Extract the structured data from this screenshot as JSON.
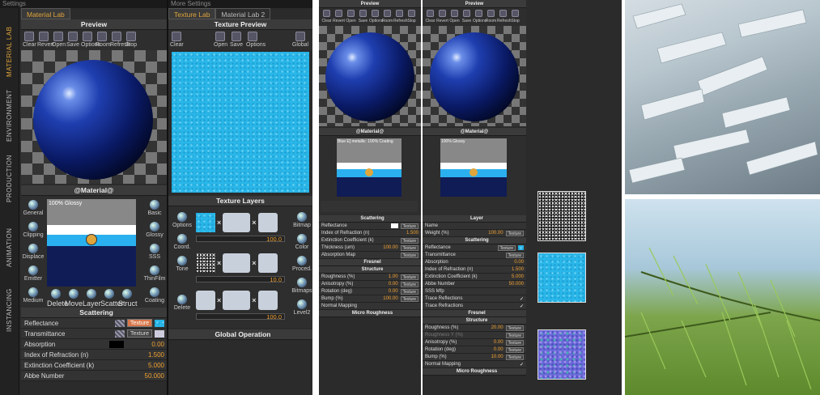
{
  "left": {
    "titlebar": "Settings",
    "tab": "Material Lab",
    "vtabs": [
      "MATERIAL LAB",
      "ENVIRONMENT",
      "PRODUCTION",
      "ANIMATION",
      "INSTANCING"
    ],
    "preview_title": "Preview",
    "toolbar": [
      "Clear",
      "Revert",
      "Open",
      "Save",
      "Options",
      "Room",
      "Refresh",
      "Stop"
    ],
    "material_title": "@Material@",
    "layer_label": "100% Glossy",
    "left_icons": [
      "General",
      "Clipping",
      "Displace",
      "Emitter",
      "Medium"
    ],
    "right_icons": [
      "Basic",
      "Glossy",
      "SSS",
      "ThinFilm",
      "Coating"
    ],
    "bottom_icons": [
      "Delete",
      "Move",
      "Layer",
      "Scatter",
      "Struct"
    ],
    "scattering_title": "Scattering",
    "rows": [
      {
        "label": "Reflectance",
        "value": "",
        "button": "Texture"
      },
      {
        "label": "Transmittance",
        "value": "",
        "button": "Texture"
      },
      {
        "label": "Absorption",
        "value": "0.00",
        "button": ""
      },
      {
        "label": "Index of Refraction (n)",
        "value": "1.500",
        "button": ""
      },
      {
        "label": "Extinction Coefficient (k)",
        "value": "5.000",
        "button": ""
      },
      {
        "label": "Abbe Number",
        "value": "50.000",
        "button": ""
      }
    ]
  },
  "mid": {
    "titlebar": "More Settings",
    "tabs": [
      "Texture Lab",
      "Material Lab 2"
    ],
    "preview_title": "Texture Preview",
    "toolbar": [
      "Clear",
      "Open",
      "Save",
      "Options",
      "Global"
    ],
    "layers_title": "Texture Layers",
    "side": [
      "Options",
      "Coord.",
      "Tone",
      "Delete"
    ],
    "right": [
      "Bitmap",
      "Color",
      "Proced.",
      "Bitmaps",
      "Level2"
    ],
    "slider_values": [
      "100.0",
      "10.0",
      "100.0"
    ],
    "global_title": "Global Operation"
  },
  "p3": {
    "preview_title": "Preview",
    "toolbar": [
      "Clear",
      "Revert",
      "Open",
      "Save",
      "Options",
      "Room",
      "Refresh",
      "Stop"
    ],
    "material_title": "@Material@",
    "layer_label": "Blue E] metallic: 100% Coating",
    "scattering_title": "Scattering",
    "rows": [
      {
        "label": "Reflectance",
        "value": "",
        "button": "Texture"
      },
      {
        "label": "Index of Refraction (n)",
        "value": "1.500",
        "button": ""
      },
      {
        "label": "Extinction Coefficient (k)",
        "value": "",
        "button": "Texture"
      },
      {
        "label": "Thickness (um)",
        "value": "100.00",
        "button": "Texture"
      },
      {
        "label": "Absorption Map",
        "value": "",
        "button": "Texture"
      }
    ],
    "fresnel_title": "Fresnel",
    "structure_title": "Structure",
    "structure_rows": [
      {
        "label": "Roughness (%)",
        "value": "1.00",
        "button": "Texture"
      },
      {
        "label": "Anisotropy (%)",
        "value": "0.00",
        "button": "Texture"
      },
      {
        "label": "Rotation (deg)",
        "value": "0.00",
        "button": "Texture"
      },
      {
        "label": "Bump (%)",
        "value": "100.00",
        "button": "Texture"
      },
      {
        "label": "Normal Mapping",
        "value": "",
        "button": ""
      }
    ],
    "micro_title": "Micro Roughness"
  },
  "p4": {
    "preview_title": "Preview",
    "toolbar": [
      "Clear",
      "Revert",
      "Open",
      "Save",
      "Options",
      "Room",
      "Refresh",
      "Stop"
    ],
    "material_title": "@Material@",
    "layer_label": "100% Glossy",
    "layer_title": "Layer",
    "layer_rows": [
      {
        "label": "Name",
        "value": "",
        "button": ""
      },
      {
        "label": "Weight (%)",
        "value": "100.00",
        "button": "Texture"
      }
    ],
    "scattering_title": "Scattering",
    "rows": [
      {
        "label": "Reflectance",
        "value": "",
        "button": "Texture"
      },
      {
        "label": "Transmittance",
        "value": "",
        "button": "Texture"
      },
      {
        "label": "Absorption",
        "value": "0.00",
        "button": ""
      },
      {
        "label": "Index of Refraction (n)",
        "value": "1.500",
        "button": ""
      },
      {
        "label": "Extinction Coefficient (k)",
        "value": "5.000",
        "button": ""
      },
      {
        "label": "Abbe Number",
        "value": "50.000",
        "button": ""
      },
      {
        "label": "SSS Mfp",
        "value": "",
        "button": ""
      },
      {
        "label": "Trace Reflections",
        "value": "",
        "button": ""
      },
      {
        "label": "Trace Refractions",
        "value": "",
        "button": ""
      }
    ],
    "fresnel_title": "Fresnel",
    "structure_title": "Structure",
    "structure_rows": [
      {
        "label": "Roughness (%)",
        "value": "20.00",
        "button": "Texture"
      },
      {
        "label": "Roughness Y (%)",
        "value": "",
        "button": "Texture"
      },
      {
        "label": "Anisotropy (%)",
        "value": "0.00",
        "button": "Texture"
      },
      {
        "label": "Rotation (deg)",
        "value": "0.00",
        "button": "Texture"
      },
      {
        "label": "Bump (%)",
        "value": "10.00",
        "button": "Texture"
      },
      {
        "label": "Normal Mapping",
        "value": "",
        "button": ""
      }
    ],
    "micro_title": "Micro Roughness"
  },
  "icons": {
    "toolbar": "toolbar-icon",
    "sphere": "material-sphere"
  }
}
